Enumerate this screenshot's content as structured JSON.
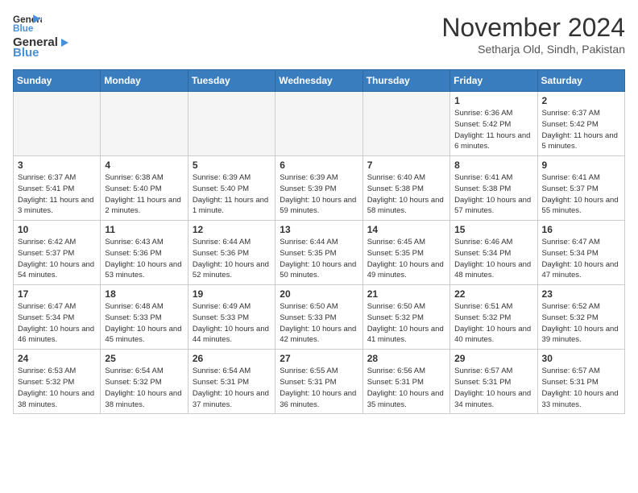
{
  "header": {
    "logo_general": "General",
    "logo_blue": "Blue",
    "title": "November 2024",
    "subtitle": "Setharja Old, Sindh, Pakistan"
  },
  "weekdays": [
    "Sunday",
    "Monday",
    "Tuesday",
    "Wednesday",
    "Thursday",
    "Friday",
    "Saturday"
  ],
  "weeks": [
    [
      {
        "day": "",
        "info": ""
      },
      {
        "day": "",
        "info": ""
      },
      {
        "day": "",
        "info": ""
      },
      {
        "day": "",
        "info": ""
      },
      {
        "day": "",
        "info": ""
      },
      {
        "day": "1",
        "info": "Sunrise: 6:36 AM\nSunset: 5:42 PM\nDaylight: 11 hours and 6 minutes."
      },
      {
        "day": "2",
        "info": "Sunrise: 6:37 AM\nSunset: 5:42 PM\nDaylight: 11 hours and 5 minutes."
      }
    ],
    [
      {
        "day": "3",
        "info": "Sunrise: 6:37 AM\nSunset: 5:41 PM\nDaylight: 11 hours and 3 minutes."
      },
      {
        "day": "4",
        "info": "Sunrise: 6:38 AM\nSunset: 5:40 PM\nDaylight: 11 hours and 2 minutes."
      },
      {
        "day": "5",
        "info": "Sunrise: 6:39 AM\nSunset: 5:40 PM\nDaylight: 11 hours and 1 minute."
      },
      {
        "day": "6",
        "info": "Sunrise: 6:39 AM\nSunset: 5:39 PM\nDaylight: 10 hours and 59 minutes."
      },
      {
        "day": "7",
        "info": "Sunrise: 6:40 AM\nSunset: 5:38 PM\nDaylight: 10 hours and 58 minutes."
      },
      {
        "day": "8",
        "info": "Sunrise: 6:41 AM\nSunset: 5:38 PM\nDaylight: 10 hours and 57 minutes."
      },
      {
        "day": "9",
        "info": "Sunrise: 6:41 AM\nSunset: 5:37 PM\nDaylight: 10 hours and 55 minutes."
      }
    ],
    [
      {
        "day": "10",
        "info": "Sunrise: 6:42 AM\nSunset: 5:37 PM\nDaylight: 10 hours and 54 minutes."
      },
      {
        "day": "11",
        "info": "Sunrise: 6:43 AM\nSunset: 5:36 PM\nDaylight: 10 hours and 53 minutes."
      },
      {
        "day": "12",
        "info": "Sunrise: 6:44 AM\nSunset: 5:36 PM\nDaylight: 10 hours and 52 minutes."
      },
      {
        "day": "13",
        "info": "Sunrise: 6:44 AM\nSunset: 5:35 PM\nDaylight: 10 hours and 50 minutes."
      },
      {
        "day": "14",
        "info": "Sunrise: 6:45 AM\nSunset: 5:35 PM\nDaylight: 10 hours and 49 minutes."
      },
      {
        "day": "15",
        "info": "Sunrise: 6:46 AM\nSunset: 5:34 PM\nDaylight: 10 hours and 48 minutes."
      },
      {
        "day": "16",
        "info": "Sunrise: 6:47 AM\nSunset: 5:34 PM\nDaylight: 10 hours and 47 minutes."
      }
    ],
    [
      {
        "day": "17",
        "info": "Sunrise: 6:47 AM\nSunset: 5:34 PM\nDaylight: 10 hours and 46 minutes."
      },
      {
        "day": "18",
        "info": "Sunrise: 6:48 AM\nSunset: 5:33 PM\nDaylight: 10 hours and 45 minutes."
      },
      {
        "day": "19",
        "info": "Sunrise: 6:49 AM\nSunset: 5:33 PM\nDaylight: 10 hours and 44 minutes."
      },
      {
        "day": "20",
        "info": "Sunrise: 6:50 AM\nSunset: 5:33 PM\nDaylight: 10 hours and 42 minutes."
      },
      {
        "day": "21",
        "info": "Sunrise: 6:50 AM\nSunset: 5:32 PM\nDaylight: 10 hours and 41 minutes."
      },
      {
        "day": "22",
        "info": "Sunrise: 6:51 AM\nSunset: 5:32 PM\nDaylight: 10 hours and 40 minutes."
      },
      {
        "day": "23",
        "info": "Sunrise: 6:52 AM\nSunset: 5:32 PM\nDaylight: 10 hours and 39 minutes."
      }
    ],
    [
      {
        "day": "24",
        "info": "Sunrise: 6:53 AM\nSunset: 5:32 PM\nDaylight: 10 hours and 38 minutes."
      },
      {
        "day": "25",
        "info": "Sunrise: 6:54 AM\nSunset: 5:32 PM\nDaylight: 10 hours and 38 minutes."
      },
      {
        "day": "26",
        "info": "Sunrise: 6:54 AM\nSunset: 5:31 PM\nDaylight: 10 hours and 37 minutes."
      },
      {
        "day": "27",
        "info": "Sunrise: 6:55 AM\nSunset: 5:31 PM\nDaylight: 10 hours and 36 minutes."
      },
      {
        "day": "28",
        "info": "Sunrise: 6:56 AM\nSunset: 5:31 PM\nDaylight: 10 hours and 35 minutes."
      },
      {
        "day": "29",
        "info": "Sunrise: 6:57 AM\nSunset: 5:31 PM\nDaylight: 10 hours and 34 minutes."
      },
      {
        "day": "30",
        "info": "Sunrise: 6:57 AM\nSunset: 5:31 PM\nDaylight: 10 hours and 33 minutes."
      }
    ]
  ]
}
